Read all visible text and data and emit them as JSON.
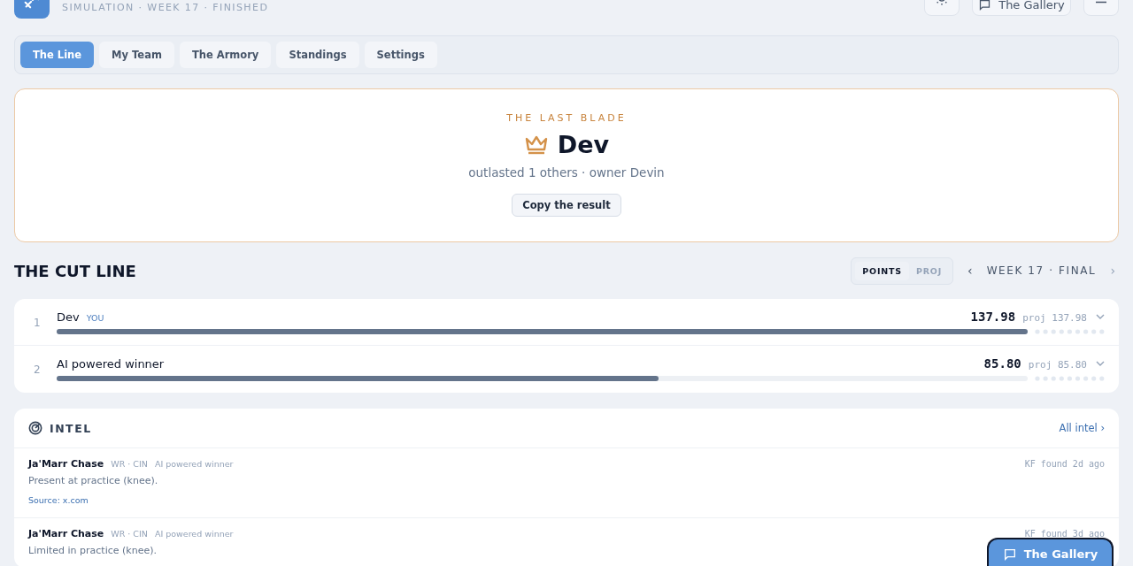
{
  "header": {
    "subtitle": "SIMULATION · WEEK 17 · FINISHED",
    "gallery_button": "The Gallery"
  },
  "tabs": [
    {
      "label": "The Line",
      "selected": true
    },
    {
      "label": "My Team",
      "selected": false
    },
    {
      "label": "The Armory",
      "selected": false
    },
    {
      "label": "Standings",
      "selected": false
    },
    {
      "label": "Settings",
      "selected": false
    }
  ],
  "winner": {
    "eyebrow": "THE LAST BLADE",
    "name": "Dev",
    "detail": "outlasted 1 others · owner Devin",
    "button": "Copy the result"
  },
  "cut_line": {
    "title": "THE CUT LINE",
    "modes": [
      {
        "label": "POINTS",
        "selected": true
      },
      {
        "label": "PROJ",
        "selected": false
      }
    ],
    "prev": "‹",
    "week": "WEEK 17 · FINAL",
    "next": "›"
  },
  "teams": [
    {
      "rank": "1",
      "name": "Dev",
      "badge": "YOU",
      "score": "137.98",
      "proj": "proj 137.98",
      "level": 1.0
    },
    {
      "rank": "2",
      "name": "AI powered winner",
      "score": "85.80",
      "proj": "proj 85.80",
      "level": 0.62
    }
  ],
  "intel": {
    "title": "INTEL",
    "link": "All intel ›",
    "items": [
      {
        "player": "Ja'Marr Chase",
        "position": "WR · CIN",
        "team": "AI powered winner",
        "time": "KF found 2d ago",
        "note": "Present at practice (knee).",
        "source": "Source: x.com"
      },
      {
        "player": "Ja'Marr Chase",
        "position": "WR · CIN",
        "team": "AI powered winner",
        "time": "KF found 3d ago",
        "note": "Limited in practice (knee)."
      }
    ]
  },
  "floating_button": "The Gallery"
}
